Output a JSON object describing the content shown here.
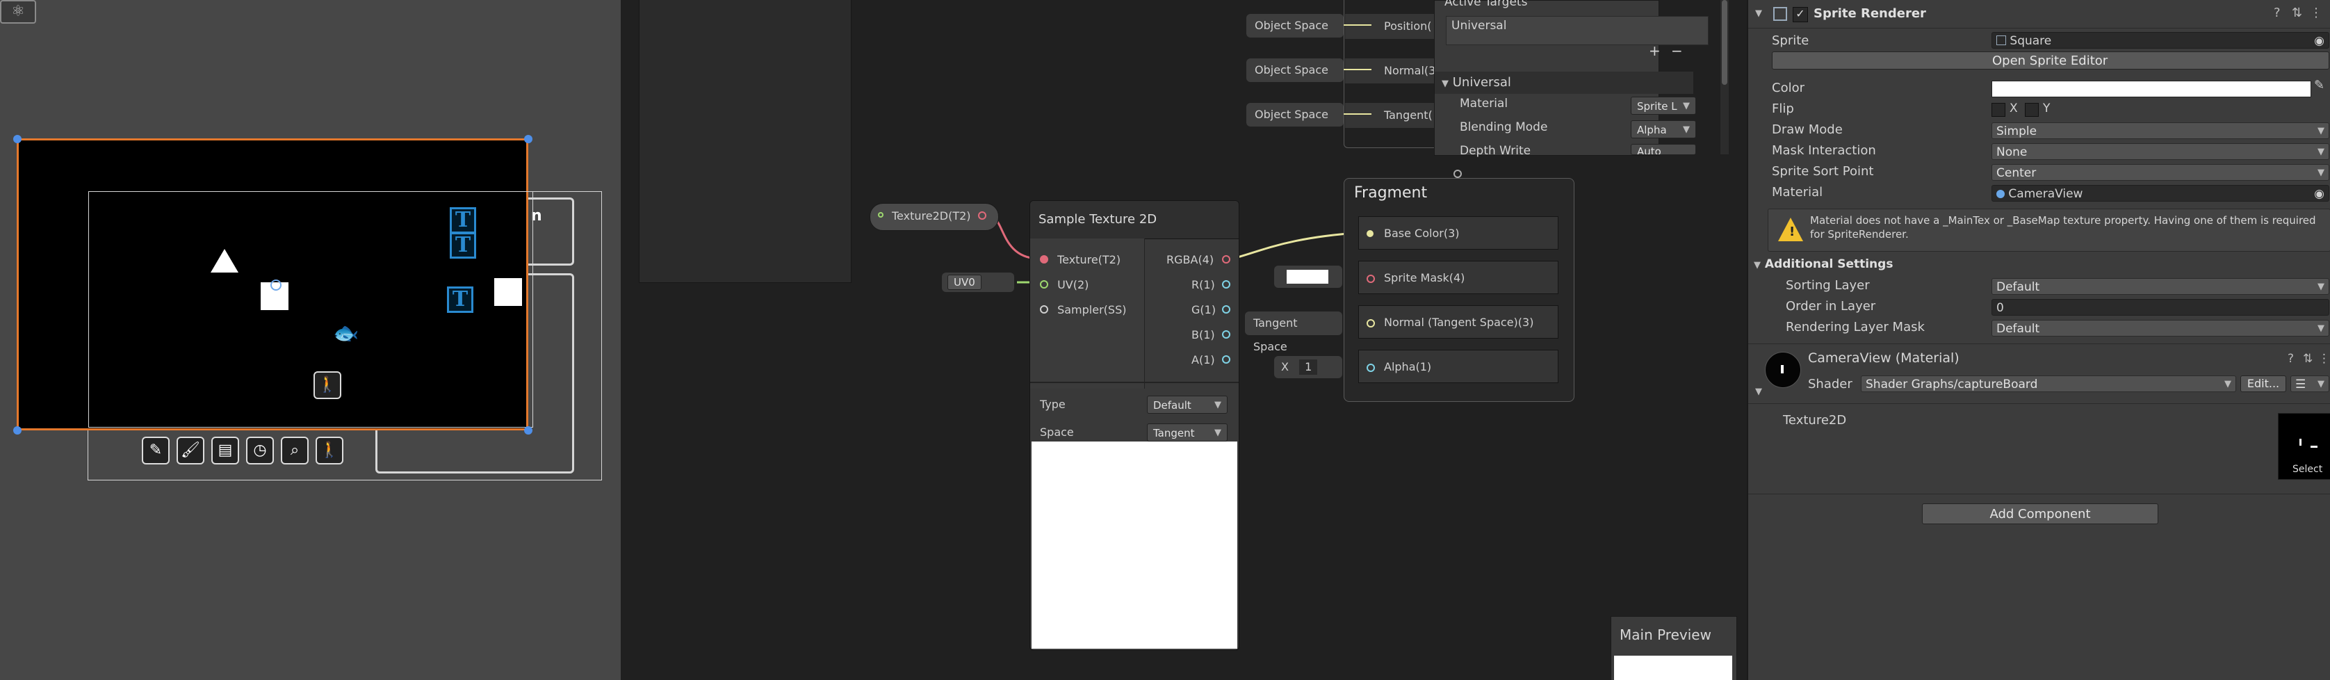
{
  "scene": {
    "tool_icon": "orbit-icon",
    "partial_text": "n",
    "t_glyph": "T",
    "toolbar_icons": [
      "pencil-icon",
      "brush-icon",
      "save-icon",
      "timer-icon",
      "zoom-icon",
      "person-icon"
    ]
  },
  "graph": {
    "object_space_1": "Object Space",
    "object_space_2": "Object Space",
    "object_space_3": "Object Space",
    "position_label": "Position(",
    "normal_label": "Normal(3",
    "tangent_label": "Tangent(",
    "texture_prop": "Texture2D(T2)",
    "uv_value": "UV0",
    "sample_node": {
      "title": "Sample Texture 2D",
      "inputs": [
        "Texture(T2)",
        "UV(2)",
        "Sampler(SS)"
      ],
      "outputs": [
        "RGBA(4)",
        "R(1)",
        "G(1)",
        "B(1)",
        "A(1)"
      ],
      "type_label": "Type",
      "type_value": "Default",
      "space_label": "Space",
      "space_value": "Tangent"
    },
    "fragment": {
      "title": "Fragment",
      "slots": [
        "Base Color(3)",
        "Sprite Mask(4)",
        "Normal (Tangent Space)(3)",
        "Alpha(1)"
      ],
      "tangent_space": "Tangent Space",
      "alpha_axis": "X",
      "alpha_value": "1"
    },
    "graph_inspector": {
      "active_targets": "Active Targets",
      "universal_item": "Universal",
      "add": "+",
      "remove": "−",
      "section": "Universal",
      "material_label": "Material",
      "material_value": "Sprite L",
      "blending_label": "Blending Mode",
      "blending_value": "Alpha",
      "depth_label": "Depth Write",
      "depth_value": "Auto"
    },
    "main_preview": "Main Preview"
  },
  "inspector": {
    "sprite_renderer": {
      "title": "Sprite Renderer",
      "sprite_label": "Sprite",
      "sprite_value": "Square",
      "open_editor": "Open Sprite Editor",
      "color_label": "Color",
      "flip_label": "Flip",
      "flip_x": "X",
      "flip_y": "Y",
      "draw_mode_label": "Draw Mode",
      "draw_mode_value": "Simple",
      "mask_label": "Mask Interaction",
      "mask_value": "None",
      "sort_point_label": "Sprite Sort Point",
      "sort_point_value": "Center",
      "material_label": "Material",
      "material_value": "CameraView",
      "warning": "Material does not have a _MainTex or _BaseMap texture property. Having one of them is required for SpriteRenderer."
    },
    "additional": {
      "title": "Additional Settings",
      "sorting_layer_label": "Sorting Layer",
      "sorting_layer_value": "Default",
      "order_label": "Order in Layer",
      "order_value": "0",
      "rendering_mask_label": "Rendering Layer Mask",
      "rendering_mask_value": "Default"
    },
    "material": {
      "title": "CameraView (Material)",
      "shader_label": "Shader",
      "shader_value": "Shader Graphs/captureBoard",
      "edit": "Edit...",
      "texture_label": "Texture2D",
      "select": "Select"
    },
    "add_component": "Add Component"
  },
  "colors": {
    "selection_orange": "#e4782c",
    "handle_blue": "#4f8fe8",
    "t_blue": "#2a8ad0",
    "warning_yellow": "#f2c12e",
    "link_pink": "#e06a7a",
    "link_yellow": "#e8e6a0",
    "link_green": "#9ed86f",
    "port_cyan": "#7fd3e6"
  }
}
